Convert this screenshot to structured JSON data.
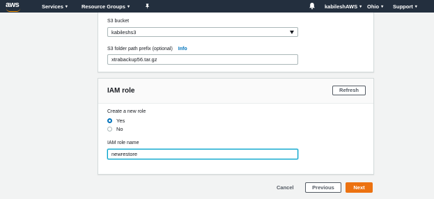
{
  "nav": {
    "logo": "aws",
    "services": "Services",
    "resource_groups": "Resource Groups",
    "user": "kabileshAWS",
    "region": "Ohio",
    "support": "Support"
  },
  "s3": {
    "bucket_label": "S3 bucket",
    "bucket_value": "kabileshs3",
    "prefix_label": "S3 folder path prefix (optional)",
    "info_link": "Info",
    "prefix_value": "xtrabackup56.tar.gz"
  },
  "iam": {
    "title": "IAM role",
    "refresh": "Refresh",
    "create_label": "Create a new role",
    "options": [
      {
        "label": "Yes",
        "checked": true
      },
      {
        "label": "No",
        "checked": false
      }
    ],
    "role_name_label": "IAM role name",
    "role_name_value": "newrestore"
  },
  "footer": {
    "cancel": "Cancel",
    "previous": "Previous",
    "next": "Next"
  },
  "colors": {
    "nav_bg": "#232f3e",
    "accent_orange": "#ec7211",
    "link_blue": "#0073bb"
  }
}
